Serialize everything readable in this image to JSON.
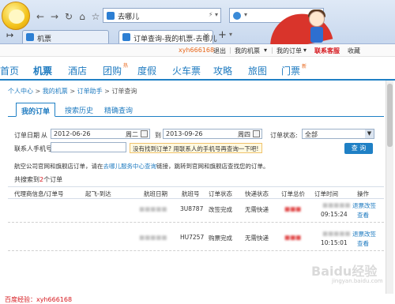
{
  "browser": {
    "address": "去哪儿",
    "tabs": [
      {
        "label": "机票",
        "active": false
      },
      {
        "label": "订单查询-我的机票-去哪儿",
        "active": true
      }
    ],
    "newtab": "+"
  },
  "topbar": {
    "user": "xyh666168",
    "logout": "退出",
    "my_tickets": "我的机票",
    "my_orders": "我的订单",
    "contact": "联系客服",
    "fav": "收藏"
  },
  "nav": {
    "items": [
      "首页",
      "机票",
      "酒店",
      "团购",
      "度假",
      "火车票",
      "攻略",
      "旅图",
      "门票"
    ],
    "tuan_badge": "热",
    "menpiao_badge": "新"
  },
  "breadcrumb": {
    "home": "个人中心",
    "sep": ">",
    "my": "我的机票",
    "helper": "订单助手",
    "current": "订单查询"
  },
  "subtabs": [
    "我的订单",
    "搜索历史",
    "精确查询"
  ],
  "form": {
    "order_date_label": "订单日期",
    "from_label": "从",
    "from_date": "2012-06-26",
    "from_weekday": "周二",
    "to_label": "到",
    "to_date": "2013-09-26",
    "to_weekday": "周四",
    "status_label": "订单状态:",
    "status_value": "全部",
    "phone_label": "联系人手机号",
    "phone_value": "",
    "tip": "没有找到订单? 用联系人的手机号再查询一下吧!",
    "search_btn": "查 询"
  },
  "note": {
    "prefix": "航空公司官网和旗舰店订单，请在",
    "link": "去哪儿服务中心查询",
    "suffix": "链接，跳转到官网和旗舰店查找您的订单。"
  },
  "count": {
    "prefix": "共搜索到",
    "num": "2",
    "suffix": "个订单"
  },
  "table": {
    "headers": [
      "代理商信息/订单号",
      "起飞-到达",
      "航班日期",
      "航班号",
      "订单状态",
      "快递状态",
      "订单总价",
      "订单时间",
      "操作"
    ],
    "rows": [
      {
        "flight": "3U8787",
        "status": "改签完成",
        "express": "无需快递",
        "time": "09:15:24",
        "ops": [
          "退票改签",
          "查看"
        ]
      },
      {
        "flight": "HU7257",
        "status": "购票完成",
        "express": "无需快递",
        "time": "10:15:01",
        "ops": [
          "退票改签",
          "查看"
        ]
      }
    ]
  },
  "footer": {
    "label": "百度经验：xyh666168"
  },
  "watermark": "Baidu经验",
  "watermark_sub": "jingyan.baidu.com",
  "colors": {
    "brand_blue": "#1f80c5",
    "accent_red": "#d6181e",
    "orange": "#e8661a"
  }
}
